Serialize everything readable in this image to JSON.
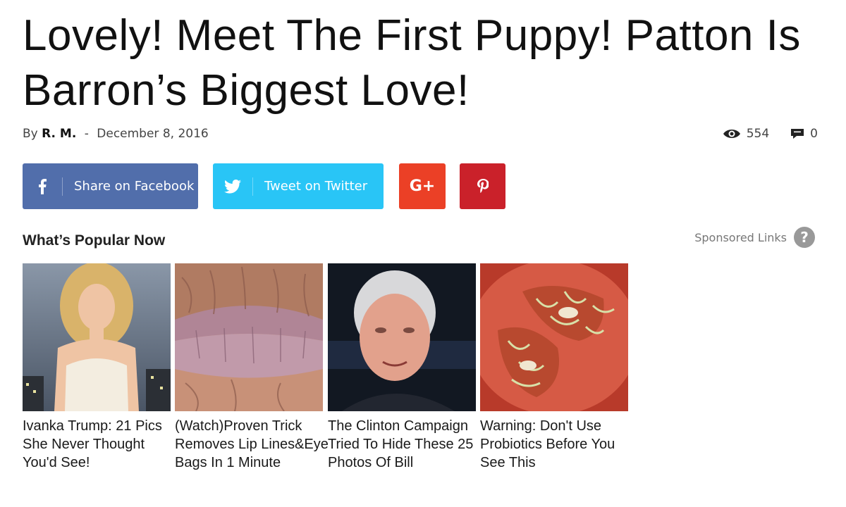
{
  "article": {
    "title": "Lovely! Meet The First Puppy! Patton Is Barron’s Biggest Love!",
    "by_label": "By",
    "author": "R. M.",
    "separator": "-",
    "date": "December 8, 2016",
    "views": "554",
    "comments": "0"
  },
  "share": {
    "facebook_label": "Share on Facebook",
    "twitter_label": "Tweet on Twitter",
    "googleplus_label": "G+",
    "colors": {
      "facebook": "#516eab",
      "twitter": "#29c5f6",
      "googleplus": "#eb4026",
      "pinterest": "#ca212a"
    }
  },
  "popular": {
    "heading": "What’s Popular Now",
    "sponsored_label": "Sponsored Links",
    "help_glyph": "?",
    "items": [
      {
        "caption": "Ivanka Trump: 21 Pics She Never Thought You'd See!",
        "thumb": "woman-in-corset-photo"
      },
      {
        "caption": "(Watch)Proven Trick Removes Lip Lines&Eye Bags In 1 Minute",
        "thumb": "wrinkled-lips-photo"
      },
      {
        "caption": "The Clinton Campaign Tried To Hide These 25 Photos Of Bill",
        "thumb": "older-man-portrait-photo"
      },
      {
        "caption": "Warning: Don't Use Probiotics Before You See This",
        "thumb": "sprouted-tomato-photo"
      }
    ]
  }
}
